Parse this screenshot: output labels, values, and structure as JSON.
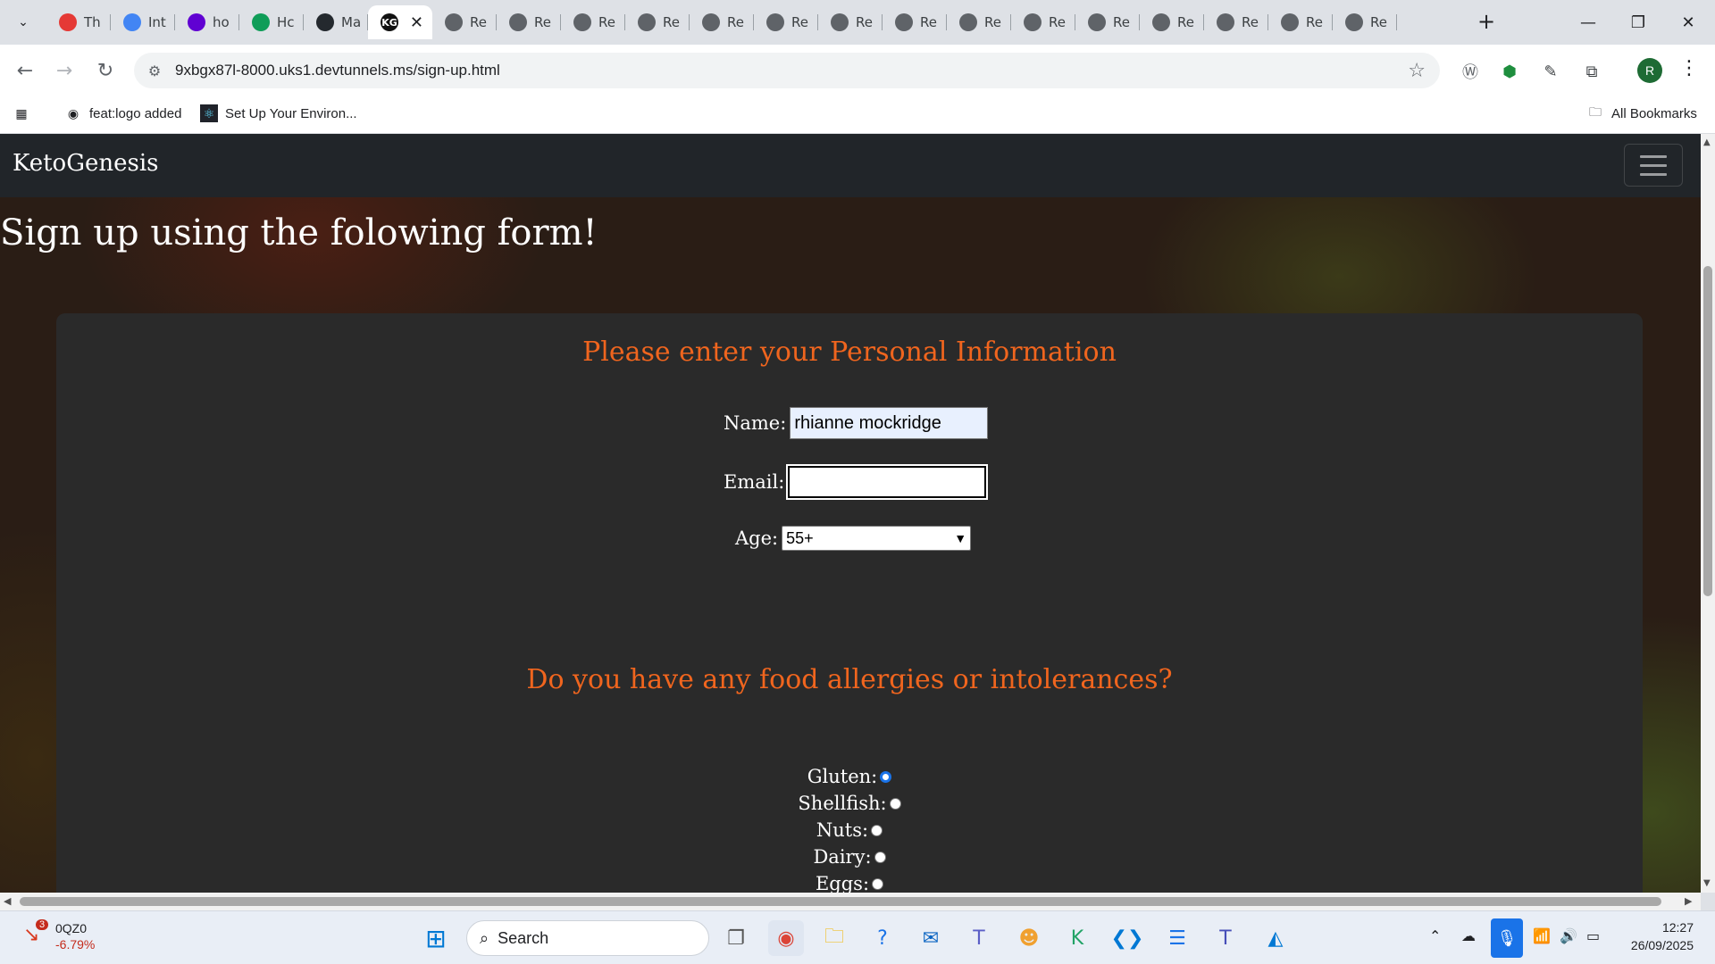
{
  "browser": {
    "tabs": [
      {
        "label": "Th",
        "icon": "opera-icon",
        "color": "#e53935"
      },
      {
        "label": "Int",
        "icon": "google-icon",
        "color": "#4285f4"
      },
      {
        "label": "ho",
        "icon": "yahoo-icon",
        "color": "#6001d2"
      },
      {
        "label": "Hc",
        "icon": "link-icon",
        "color": "#0f9d58"
      },
      {
        "label": "Ma",
        "icon": "github-icon",
        "color": "#24292e"
      },
      {
        "label": "KG",
        "icon": "ketogenesis-icon",
        "color": "#111111",
        "active": true
      },
      {
        "label": "Re",
        "icon": "globe-icon",
        "color": "#5f6368"
      },
      {
        "label": "Re",
        "icon": "globe-icon",
        "color": "#5f6368"
      },
      {
        "label": "Re",
        "icon": "globe-icon",
        "color": "#5f6368"
      },
      {
        "label": "Re",
        "icon": "globe-icon",
        "color": "#5f6368"
      },
      {
        "label": "Re",
        "icon": "globe-icon",
        "color": "#5f6368"
      },
      {
        "label": "Re",
        "icon": "globe-icon",
        "color": "#5f6368"
      },
      {
        "label": "Re",
        "icon": "globe-icon",
        "color": "#5f6368"
      },
      {
        "label": "Re",
        "icon": "globe-icon",
        "color": "#5f6368"
      },
      {
        "label": "Re",
        "icon": "globe-icon",
        "color": "#5f6368"
      },
      {
        "label": "Re",
        "icon": "globe-icon",
        "color": "#5f6368"
      },
      {
        "label": "Re",
        "icon": "globe-icon",
        "color": "#5f6368"
      },
      {
        "label": "Re",
        "icon": "globe-icon",
        "color": "#5f6368"
      },
      {
        "label": "Re",
        "icon": "globe-icon",
        "color": "#5f6368"
      },
      {
        "label": "Re",
        "icon": "globe-icon",
        "color": "#5f6368"
      },
      {
        "label": "Re",
        "icon": "globe-icon",
        "color": "#5f6368"
      }
    ],
    "url": "9xbgx87l-8000.uks1.devtunnels.ms/sign-up.html",
    "bookmarks": [
      {
        "label": "feat:logo added",
        "icon": "github-icon"
      },
      {
        "label": "Set Up Your Environ...",
        "icon": "react-icon"
      }
    ],
    "all_bookmarks": "All Bookmarks",
    "profile_initial": "R"
  },
  "site": {
    "brand": "KetoGenesis",
    "page_heading": "Sign up using the folowing form!",
    "personal_title": "Please enter your Personal Information",
    "name_label": "Name:",
    "name_value": "rhianne mockridge",
    "email_label": "Email:",
    "email_value": "",
    "age_label": "Age:",
    "age_selected": "55+",
    "allergy_title": "Do you have any food allergies or intolerances?",
    "allergies": [
      {
        "label": "Gluten:",
        "checked": false,
        "focused": true
      },
      {
        "label": "Shellfish:",
        "checked": false
      },
      {
        "label": "Nuts:",
        "checked": false
      },
      {
        "label": "Dairy:",
        "checked": false
      },
      {
        "label": "Eggs:",
        "checked": false
      }
    ],
    "colors": {
      "accent": "#f0651e",
      "card": "#2a2a2a",
      "navbar": "#212529"
    }
  },
  "taskbar": {
    "stock_badge": "3",
    "stock_symbol": "0QZ0",
    "stock_change": "-6.79%",
    "search_label": "Search",
    "time": "12:27",
    "date": "26/09/2025"
  }
}
